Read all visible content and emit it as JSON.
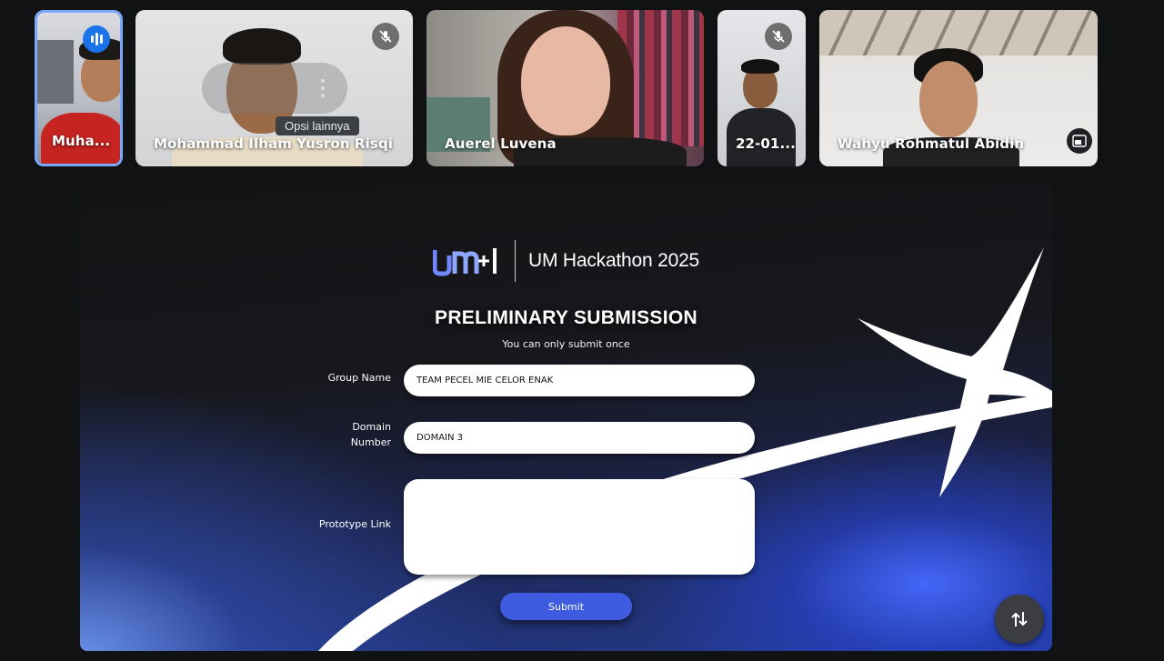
{
  "participants": [
    {
      "name": "Muha...",
      "speaking": true
    },
    {
      "name": "Mohammad Ilham Yusron Risqi",
      "muted": true
    },
    {
      "name": "Auerel Luvena"
    },
    {
      "name": "22-01...",
      "muted": true
    },
    {
      "name": "Wahyu Rohmatul Abidin"
    }
  ],
  "tooltip": "Opsi lainnya",
  "presentation": {
    "brand": "UM Hackathon 2025",
    "title": "PRELIMINARY SUBMISSION",
    "subtitle": "You can only submit once",
    "form": {
      "group_name_label": "Group Name",
      "group_name_value": "TEAM PECEL MIE CELOR ENAK",
      "domain_label_line1": "Domain",
      "domain_label_line2": "Number",
      "domain_value": "DOMAIN 3",
      "prototype_label": "Prototype Link",
      "prototype_value": "",
      "submit_label": "Submit"
    }
  },
  "colors": {
    "accent": "#3f5be0",
    "speaking_indicator": "#1a73e8",
    "active_border": "#7aa7f7"
  },
  "icons": [
    "speaking-icon",
    "mic-off-icon",
    "more-options-icon",
    "pip-icon",
    "present-toggle-icon"
  ]
}
